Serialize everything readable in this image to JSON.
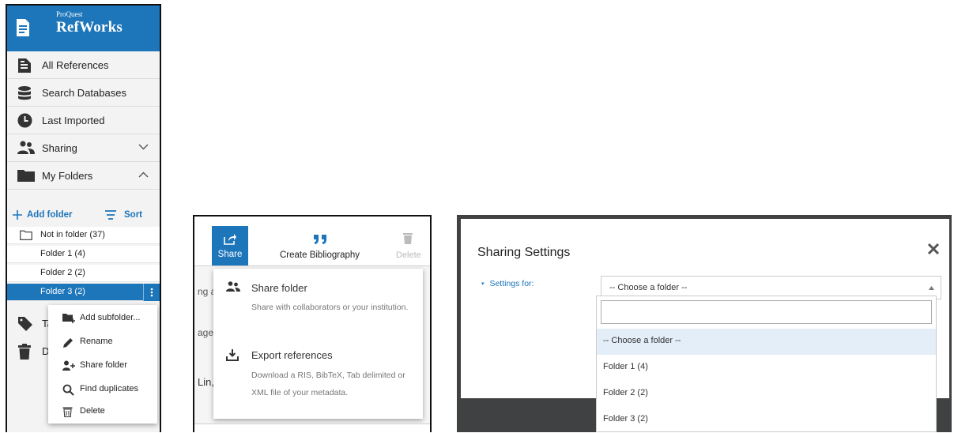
{
  "panel1": {
    "brand_small": "ProQuest",
    "brand_name": "RefWorks",
    "nav": {
      "all_references": "All References",
      "search_databases": "Search Databases",
      "last_imported": "Last Imported",
      "sharing": "Sharing",
      "my_folders": "My Folders"
    },
    "add_folder": "Add folder",
    "sort": "Sort",
    "folders": {
      "not_in_folder": "Not in folder (37)",
      "folder1": "Folder 1 (4)",
      "folder2": "Folder 2 (2)",
      "folder3": "Folder 3 (2)"
    },
    "tags_partial": "Tag",
    "deleted_partial": "Del",
    "context_menu": {
      "add_subfolder": "Add subfolder...",
      "rename": "Rename",
      "share_folder": "Share folder",
      "find_duplicates": "Find duplicates",
      "delete": "Delete"
    },
    "colors": {
      "brand_blue": "#1d75ba"
    }
  },
  "panel2": {
    "toolbar": {
      "share": "Share",
      "create_bibliography": "Create Bibliography",
      "delete": "Delete"
    },
    "background_fragments": {
      "line1": "ng a",
      "line2": "age",
      "line3": "Lin,"
    },
    "menu": {
      "share_title": "Share folder",
      "share_desc": "Share with collaborators or your institution.",
      "export_title": "Export references",
      "export_desc": "Download a RIS, BibTeX, Tab delimited or XML file of your metadata."
    }
  },
  "panel3": {
    "title": "Sharing Settings",
    "settings_for_label": "Settings for:",
    "selected_value": "-- Choose a folder --",
    "search_value": "",
    "options": [
      "-- Choose a folder --",
      "Folder 1 (4)",
      "Folder 2 (2)",
      "Folder 3 (2)"
    ]
  }
}
